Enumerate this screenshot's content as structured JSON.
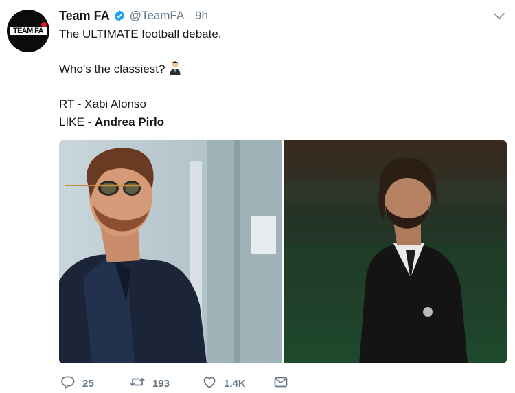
{
  "author": {
    "display_name": "Team FA",
    "handle": "@TeamFA",
    "separator": "·",
    "time": "9h",
    "avatar_text": "TEAM FA",
    "verified": true
  },
  "tweet": {
    "line1": "The ULTIMATE football debate.",
    "line2": "Who's the classiest?",
    "line3": "RT - Xabi Alonso",
    "line4_prefix": "LIKE - ",
    "line4_bold": "Andrea Pirlo"
  },
  "media": [
    {
      "subject": "man-in-sunglasses-navy-blazer"
    },
    {
      "subject": "man-in-black-club-suit"
    }
  ],
  "actions": {
    "replies": "25",
    "retweets": "193",
    "likes": "1.4K"
  },
  "colors": {
    "text": "#14171a",
    "secondary": "#657786",
    "verified": "#1da1f2",
    "avatar_bg": "#0b0b0b",
    "avatar_dot": "#e0192b"
  },
  "icons": [
    "verified-badge-icon",
    "chevron-down-icon",
    "man-in-suit-emoji",
    "reply-icon",
    "retweet-icon",
    "like-icon",
    "direct-message-icon"
  ]
}
